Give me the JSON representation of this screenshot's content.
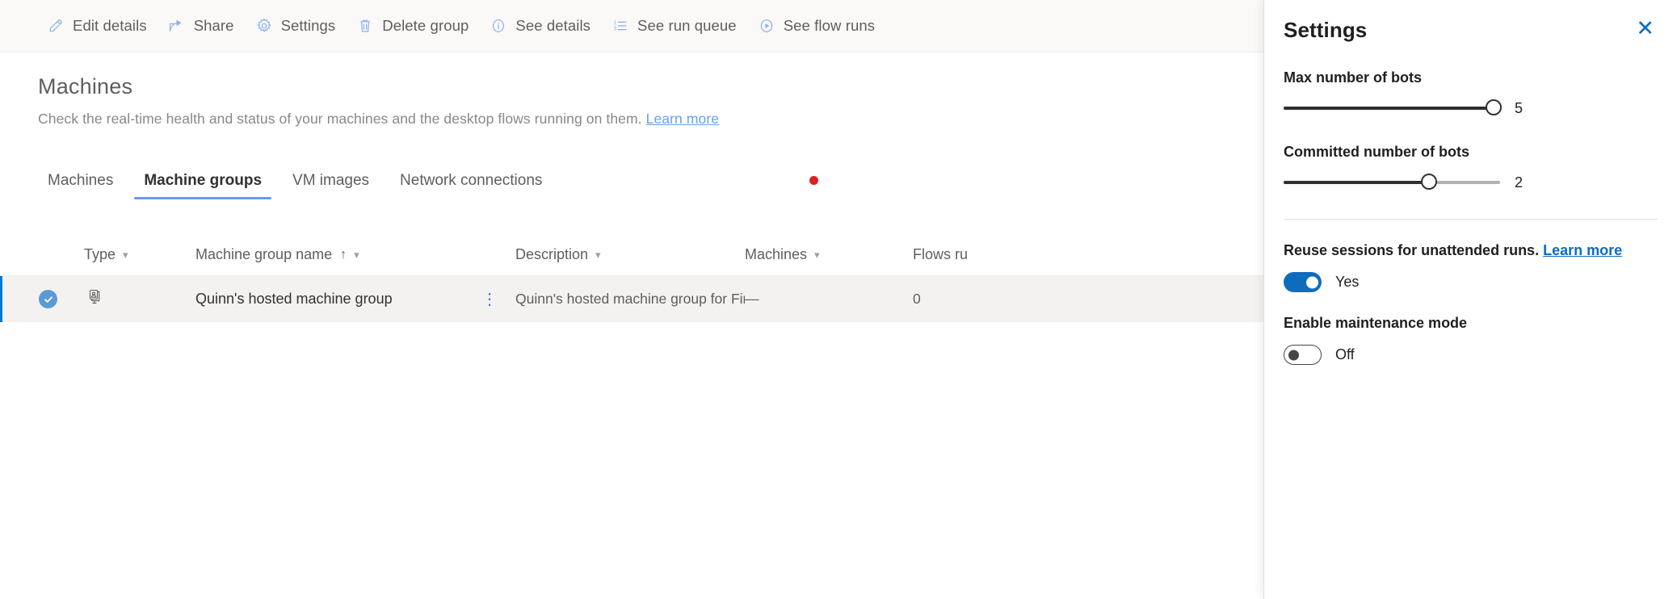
{
  "toolbar": {
    "items": [
      {
        "label": "Edit details",
        "icon": "pencil-icon"
      },
      {
        "label": "Share",
        "icon": "share-icon"
      },
      {
        "label": "Settings",
        "icon": "gear-icon"
      },
      {
        "label": "Delete group",
        "icon": "trash-icon"
      },
      {
        "label": "See details",
        "icon": "info-icon"
      },
      {
        "label": "See run queue",
        "icon": "list-ordered-icon"
      },
      {
        "label": "See flow runs",
        "icon": "play-circle-icon"
      }
    ]
  },
  "page": {
    "title": "Machines",
    "subtitle": "Check the real-time health and status of your machines and the desktop flows running on them.",
    "subtitle_link": "Learn more"
  },
  "tabs": {
    "items": [
      {
        "label": "Machines",
        "active": false
      },
      {
        "label": "Machine groups",
        "active": true
      },
      {
        "label": "VM images",
        "active": false
      },
      {
        "label": "Network connections",
        "active": false
      }
    ],
    "notification_dot_color": "#e02020"
  },
  "table": {
    "columns": [
      {
        "label": "Type",
        "sortable": true,
        "sorted": false
      },
      {
        "label": "Machine group name",
        "sortable": true,
        "sorted": true,
        "sort_direction": "↑"
      },
      {
        "label": "Description",
        "sortable": true,
        "sorted": false
      },
      {
        "label": "Machines",
        "sortable": true,
        "sorted": false
      },
      {
        "label": "Flows ru",
        "sortable": false,
        "sorted": false
      }
    ],
    "rows": [
      {
        "selected": true,
        "type_icon": "hosted-machine-group-icon",
        "name": "Quinn's hosted machine group",
        "description": "Quinn's hosted machine group for Financ...",
        "machines": "—",
        "flows_running": "0",
        "overflow_menu": "⋮"
      }
    ]
  },
  "panel": {
    "title": "Settings",
    "close_label": "✕",
    "max_bots": {
      "label": "Max number of bots",
      "value": "5",
      "fill_percent": 100
    },
    "committed_bots": {
      "label": "Committed number of bots",
      "value": "2",
      "fill_percent": 67
    },
    "reuse_sessions": {
      "label": "Reuse sessions for unattended runs.",
      "link": "Learn more",
      "state": "Yes",
      "on": true
    },
    "maintenance_mode": {
      "label": "Enable maintenance mode",
      "state": "Off",
      "on": false
    }
  }
}
